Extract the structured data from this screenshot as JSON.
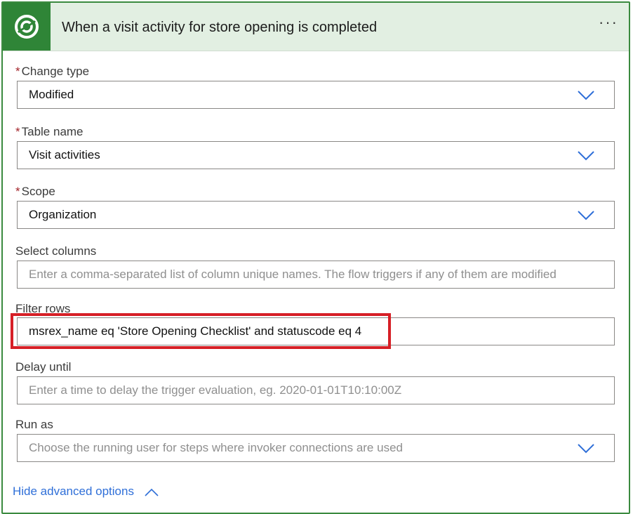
{
  "header": {
    "title": "When a visit activity for store opening is completed",
    "more_label": "···",
    "logo_icon": "dataverse-logo-icon",
    "color": "#2f8537"
  },
  "fields": {
    "change_type": {
      "label": "Change type",
      "required": "*",
      "value": "Modified"
    },
    "table_name": {
      "label": "Table name",
      "required": "*",
      "value": "Visit activities"
    },
    "scope": {
      "label": "Scope",
      "required": "*",
      "value": "Organization"
    },
    "select_columns": {
      "label": "Select columns",
      "placeholder": "Enter a comma-separated list of column unique names. The flow triggers if any of them are modified"
    },
    "filter_rows": {
      "label": "Filter rows",
      "value": "msrex_name eq 'Store Opening Checklist' and statuscode eq 4"
    },
    "delay_until": {
      "label": "Delay until",
      "placeholder": "Enter a time to delay the trigger evaluation, eg. 2020-01-01T10:10:00Z"
    },
    "run_as": {
      "label": "Run as",
      "placeholder": "Choose the running user for steps where invoker connections are used"
    }
  },
  "footer": {
    "hide_advanced_label": "Hide advanced options"
  },
  "colors": {
    "accent_link": "#2f6fd8",
    "highlight_border": "#d61f26",
    "chevron": "#2f6fd8"
  }
}
